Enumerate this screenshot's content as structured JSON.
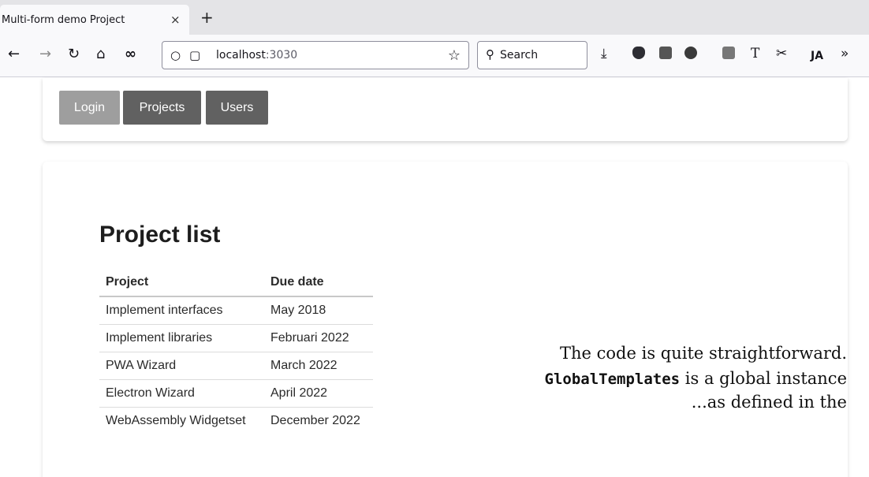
{
  "browser": {
    "tab_title": "Multi-form demo Project",
    "tab_close": "×",
    "new_tab": "+",
    "url_host": "localhost",
    "url_port": ":3030",
    "search_placeholder": "Search",
    "icons": [
      "back-icon",
      "forward-icon",
      "reload-icon",
      "home-icon",
      "infinity-icon",
      "shield-icon",
      "page-icon",
      "bookmark-star-icon",
      "search-icon",
      "download-icon",
      "overflow-icon"
    ]
  },
  "nav": {
    "login": "Login",
    "projects": "Projects",
    "users": "Users"
  },
  "colors": {
    "login_bg": "#9e9e9e",
    "active_bg": "#616161"
  },
  "main": {
    "title": "Project list",
    "table": {
      "headers": [
        "Project",
        "Due date"
      ],
      "rows": [
        [
          "Implement interfaces",
          "May 2018"
        ],
        [
          "Implement libraries",
          "Februari 2022"
        ],
        [
          "PWA Wizard",
          "March 2022"
        ],
        [
          "Electron Wizard",
          "April 2022"
        ],
        [
          "WebAssembly Widgetset",
          "December 2022"
        ]
      ]
    }
  },
  "overlay": {
    "line1": "The code is quite straightforward.",
    "line2_code": "GlobalTemplates",
    "line2_rest": " is a global instance",
    "line3": "...as defined in the"
  }
}
